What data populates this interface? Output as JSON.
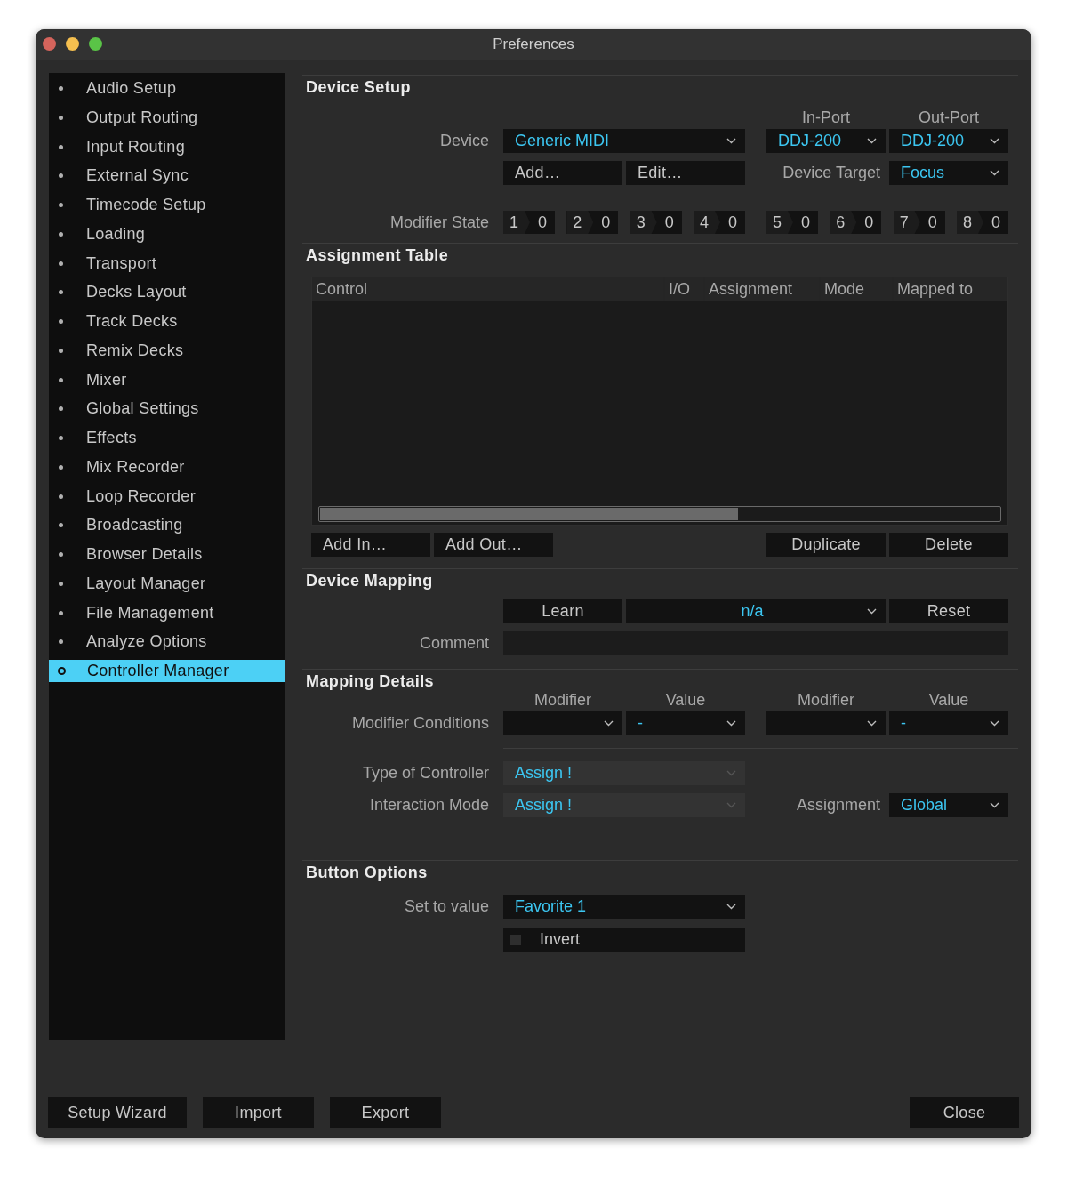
{
  "window": {
    "title": "Preferences"
  },
  "sidebar": {
    "items": [
      {
        "label": "Audio Setup",
        "selected": false
      },
      {
        "label": "Output Routing",
        "selected": false
      },
      {
        "label": "Input Routing",
        "selected": false
      },
      {
        "label": "External Sync",
        "selected": false
      },
      {
        "label": "Timecode Setup",
        "selected": false
      },
      {
        "label": "Loading",
        "selected": false
      },
      {
        "label": "Transport",
        "selected": false
      },
      {
        "label": "Decks Layout",
        "selected": false
      },
      {
        "label": "Track Decks",
        "selected": false
      },
      {
        "label": "Remix Decks",
        "selected": false
      },
      {
        "label": "Mixer",
        "selected": false
      },
      {
        "label": "Global Settings",
        "selected": false
      },
      {
        "label": "Effects",
        "selected": false
      },
      {
        "label": "Mix Recorder",
        "selected": false
      },
      {
        "label": "Loop Recorder",
        "selected": false
      },
      {
        "label": "Broadcasting",
        "selected": false
      },
      {
        "label": "Browser Details",
        "selected": false
      },
      {
        "label": "Layout Manager",
        "selected": false
      },
      {
        "label": "File Management",
        "selected": false
      },
      {
        "label": "Analyze Options",
        "selected": false
      },
      {
        "label": "Controller Manager",
        "selected": true
      }
    ]
  },
  "device_setup": {
    "title": "Device Setup",
    "in_port_header": "In-Port",
    "out_port_header": "Out-Port",
    "device_label": "Device",
    "device": {
      "value": "Generic MIDI",
      "disabled": false
    },
    "in_port": {
      "value": "DDJ-200",
      "disabled": false
    },
    "out_port": {
      "value": "DDJ-200",
      "disabled": false
    },
    "add_button": "Add…",
    "edit_button": "Edit…",
    "device_target_label": "Device Target",
    "device_target": {
      "value": "Focus",
      "disabled": false
    },
    "modifier_state_label": "Modifier State",
    "modifier_state": [
      {
        "number": "1",
        "value": "0"
      },
      {
        "number": "2",
        "value": "0"
      },
      {
        "number": "3",
        "value": "0"
      },
      {
        "number": "4",
        "value": "0"
      },
      {
        "number": "5",
        "value": "0"
      },
      {
        "number": "6",
        "value": "0"
      },
      {
        "number": "7",
        "value": "0"
      },
      {
        "number": "8",
        "value": "0"
      }
    ]
  },
  "assignment_table": {
    "title": "Assignment Table",
    "columns": [
      "Control",
      "I/O",
      "Assignment",
      "Mode",
      "Mapped to"
    ],
    "left_buttons": [
      "Add In…",
      "Add Out…"
    ],
    "right_buttons": [
      "Duplicate",
      "Delete"
    ]
  },
  "device_mapping": {
    "title": "Device Mapping",
    "learn_button": "Learn",
    "mapping": {
      "value": "n/a",
      "disabled": false
    },
    "reset_button": "Reset",
    "comment_label": "Comment"
  },
  "mapping_details": {
    "title": "Mapping Details",
    "condition_headers": [
      "Modifier",
      "Value",
      "Modifier",
      "Value"
    ],
    "modifier_conditions_label": "Modifier Conditions",
    "modifier_conditions": [
      {
        "disabled": false
      },
      {
        "value": "-",
        "disabled": false
      },
      {
        "disabled": false
      },
      {
        "value": "-",
        "disabled": false
      }
    ],
    "type_of_controller_label": "Type of Controller",
    "type_of_controller": {
      "value": "Assign !",
      "disabled": true
    },
    "interaction_mode_label": "Interaction Mode",
    "interaction_mode": {
      "value": "Assign !",
      "disabled": true
    },
    "assignment_label": "Assignment",
    "assignment": {
      "value": "Global",
      "disabled": false
    }
  },
  "button_options": {
    "title": "Button Options",
    "set_to_value_label": "Set to value",
    "set_to_value": {
      "value": "Favorite 1",
      "disabled": false
    },
    "invert": {
      "label": "Invert",
      "checked": false
    }
  },
  "footer": {
    "left_buttons": [
      "Setup Wizard",
      "Import",
      "Export"
    ],
    "close_button": "Close"
  }
}
